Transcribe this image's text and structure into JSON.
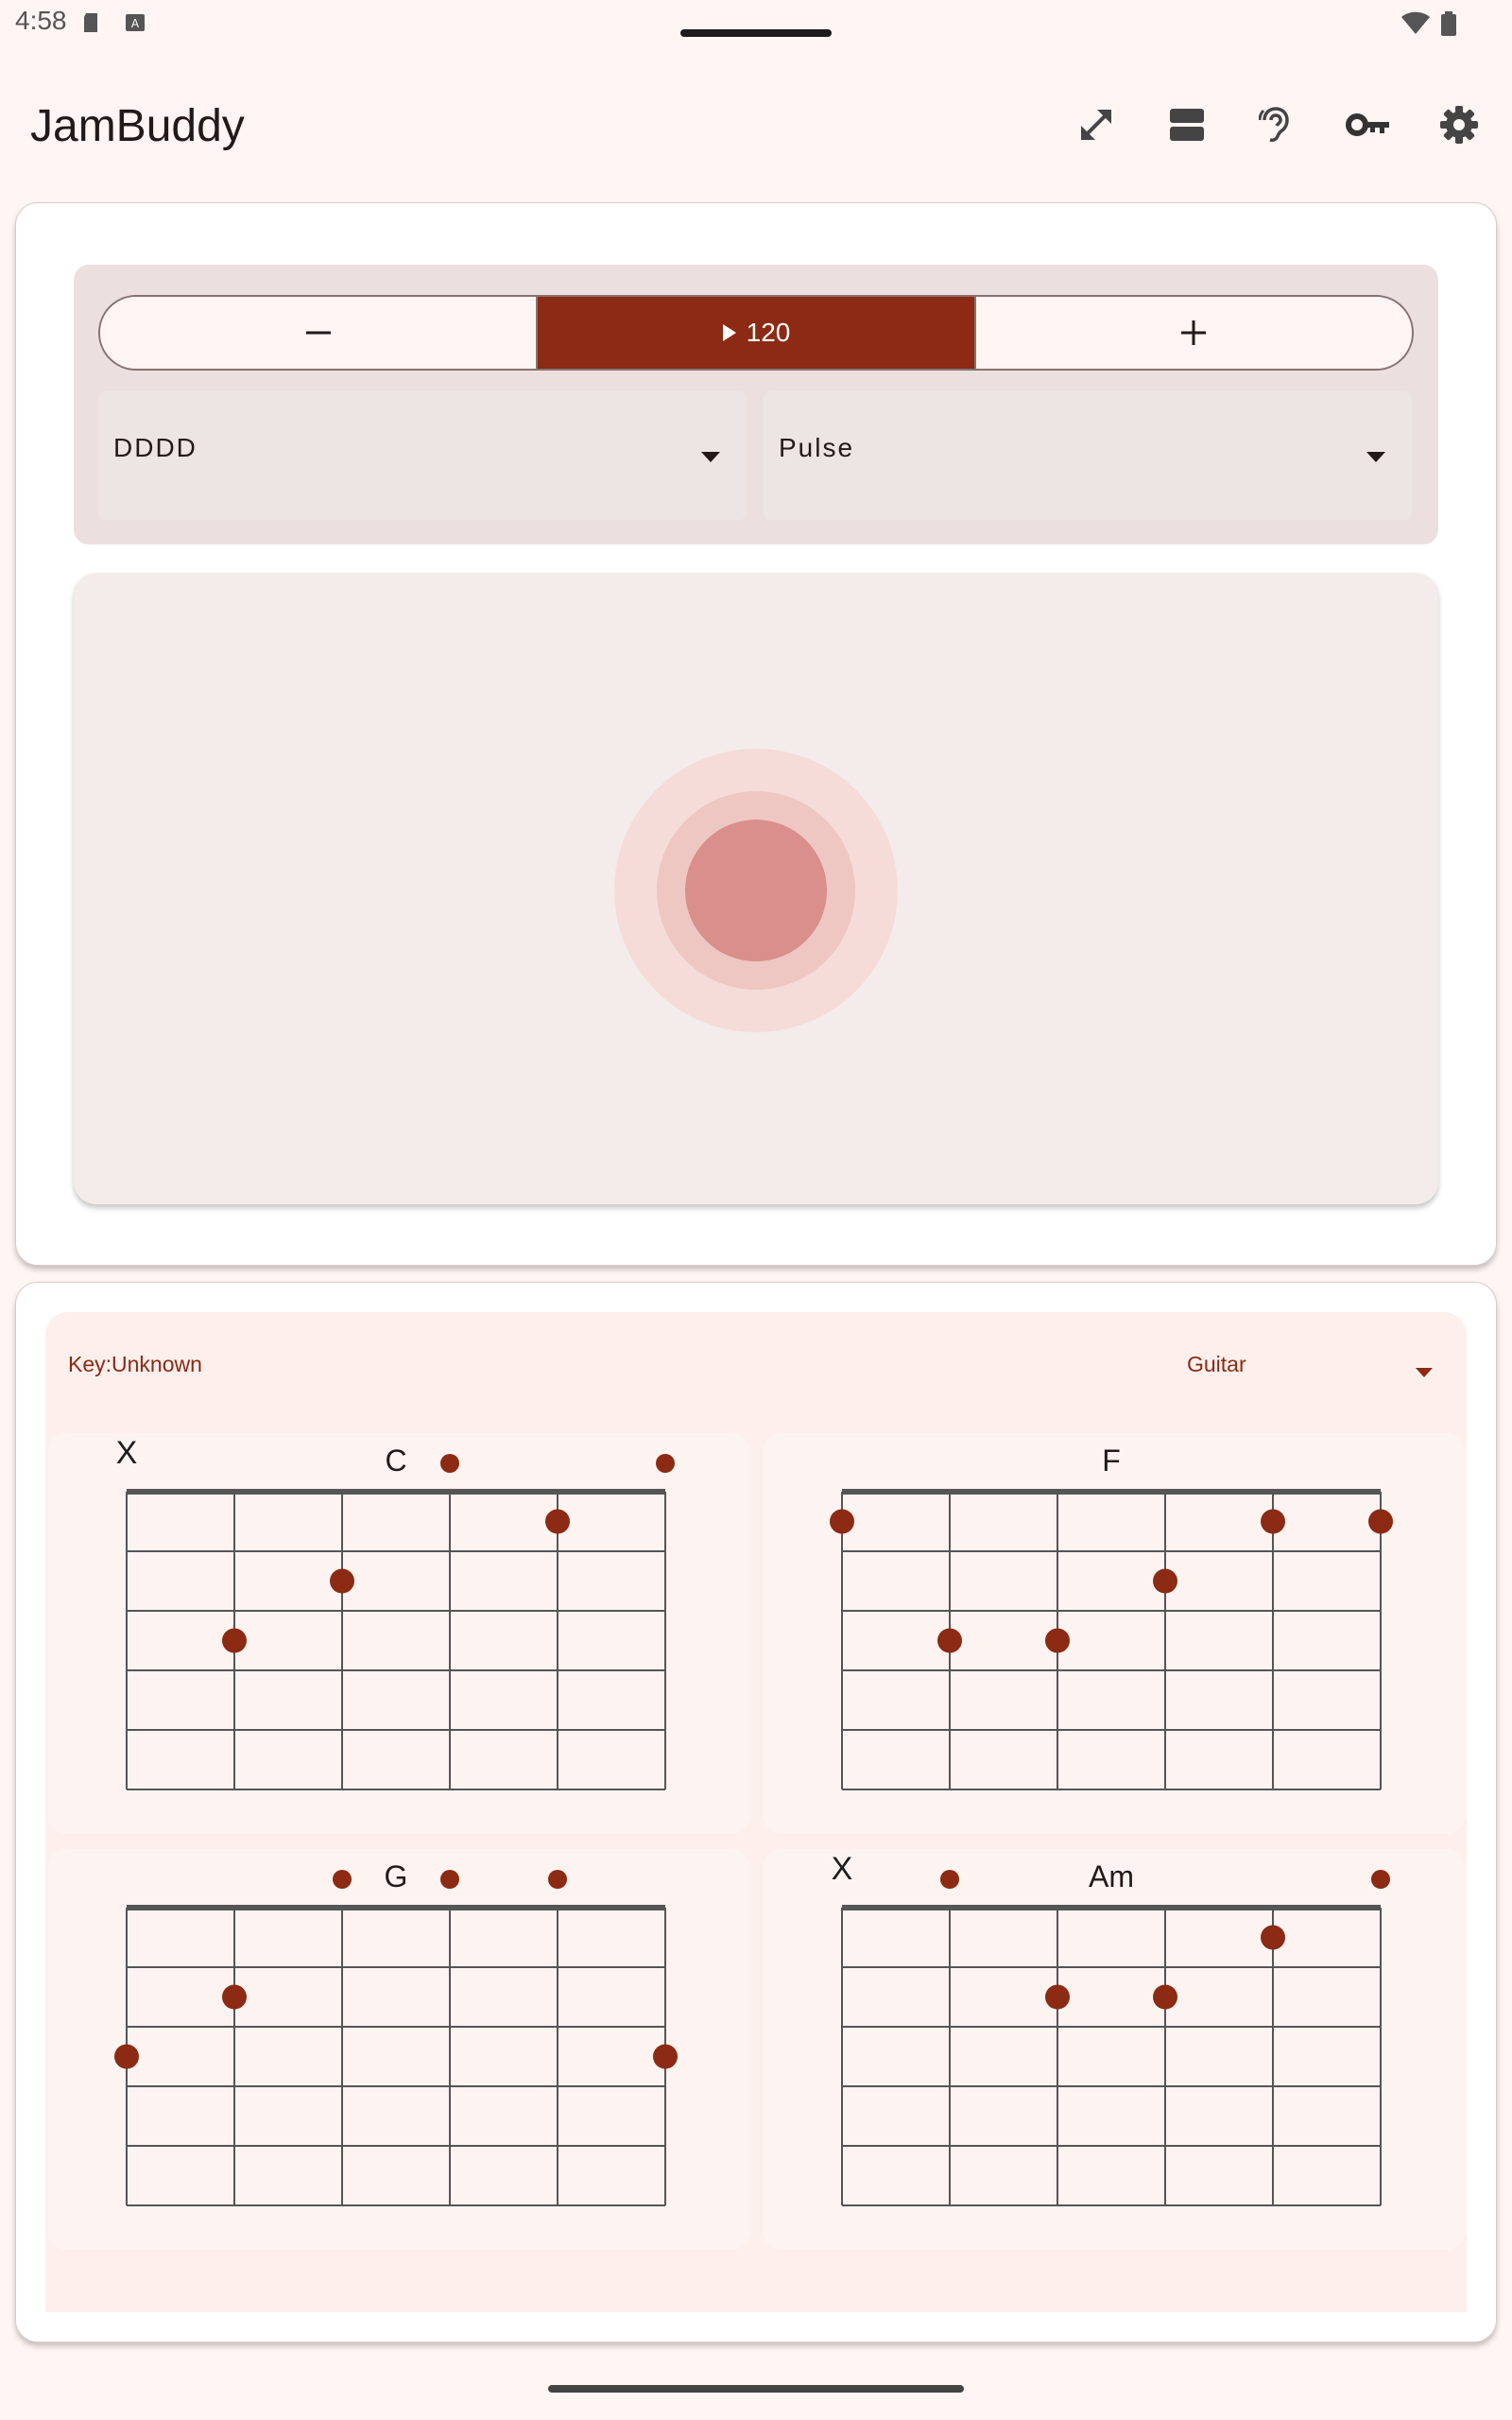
{
  "status_bar": {
    "time": "4:58"
  },
  "app_bar": {
    "title": "JamBuddy",
    "actions": [
      "fullscreen-icon",
      "layout-icon",
      "hearing-icon",
      "key-icon",
      "settings-icon"
    ]
  },
  "tempo": {
    "decrease_symbol": "−",
    "bpm": "120",
    "increase_symbol": "+"
  },
  "strum_pattern": {
    "value": "DDDD"
  },
  "sound": {
    "value": "Pulse"
  },
  "chords_panel": {
    "key_label": "Key:",
    "key_value": "Unknown",
    "instrument": "Guitar"
  },
  "chords": [
    {
      "name": "C",
      "frets": [
        "x",
        3,
        2,
        0,
        1,
        0
      ]
    },
    {
      "name": "F",
      "frets": [
        1,
        3,
        3,
        2,
        1,
        1
      ]
    },
    {
      "name": "G",
      "frets": [
        3,
        2,
        0,
        0,
        0,
        3
      ]
    },
    {
      "name": "Am",
      "frets": [
        "x",
        0,
        2,
        2,
        1,
        0
      ]
    }
  ],
  "colors": {
    "accent": "#8c2a13",
    "pulse_core": "#d98f8b",
    "pulse_ring": "#eec7c3",
    "pulse_halo": "#f5dcd9"
  }
}
